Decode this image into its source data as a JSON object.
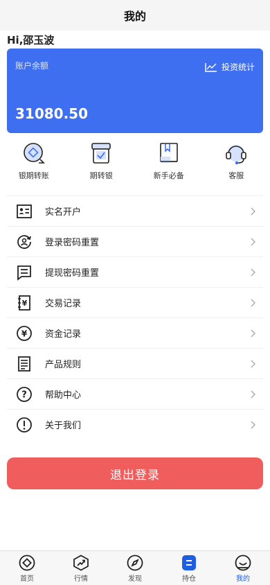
{
  "header": {
    "title": "我的"
  },
  "greeting": "Hi,邵玉波",
  "balance_card": {
    "label": "账户余额",
    "amount": "31080.50",
    "stats_label": "投资统计",
    "background": "#3e6ff0"
  },
  "quick_actions": [
    {
      "label": "银期转账",
      "icon": "bank-transfer-icon"
    },
    {
      "label": "期转银",
      "icon": "futures-to-bank-icon"
    },
    {
      "label": "新手必备",
      "icon": "book-icon"
    },
    {
      "label": "客服",
      "icon": "headset-icon"
    }
  ],
  "menu": [
    {
      "label": "实名开户",
      "icon": "id-card-icon"
    },
    {
      "label": "登录密码重置",
      "icon": "user-reset-icon"
    },
    {
      "label": "提现密码重置",
      "icon": "message-icon"
    },
    {
      "label": "交易记录",
      "icon": "yen-book-icon"
    },
    {
      "label": "资金记录",
      "icon": "yen-circle-icon"
    },
    {
      "label": "产品规则",
      "icon": "document-icon"
    },
    {
      "label": "帮助中心",
      "icon": "question-icon"
    },
    {
      "label": "关于我们",
      "icon": "info-icon"
    }
  ],
  "logout": {
    "label": "退出登录",
    "color": "#ef5d5d"
  },
  "tabbar": [
    {
      "label": "首页",
      "icon": "home-icon"
    },
    {
      "label": "行情",
      "icon": "market-icon"
    },
    {
      "label": "发现",
      "icon": "compass-icon"
    },
    {
      "label": "持仓",
      "icon": "holdings-icon"
    },
    {
      "label": "我的",
      "icon": "profile-icon",
      "active": true
    }
  ],
  "accent_color": "#1d5fe0"
}
